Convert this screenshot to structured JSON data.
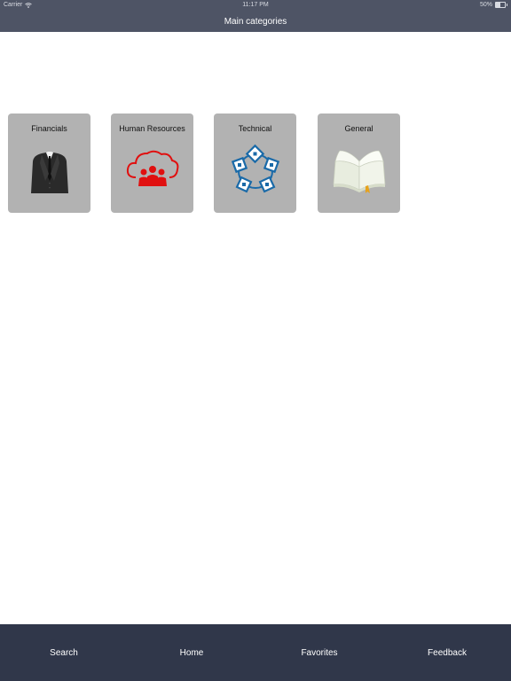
{
  "status_bar": {
    "carrier": "Carrier",
    "time": "11:17 PM",
    "battery": "50%"
  },
  "nav": {
    "title": "Main categories"
  },
  "categories": [
    {
      "label": "Financials",
      "icon": "suit-icon"
    },
    {
      "label": "Human Resources",
      "icon": "hr-cloud-people-icon"
    },
    {
      "label": "Technical",
      "icon": "network-cycle-icon"
    },
    {
      "label": "General",
      "icon": "open-book-icon"
    }
  ],
  "tabs": [
    {
      "label": "Search"
    },
    {
      "label": "Home"
    },
    {
      "label": "Favorites"
    },
    {
      "label": "Feedback"
    }
  ],
  "colors": {
    "header": "#4e5465",
    "tab_bar": "#30374a",
    "tile": "#b2b2b2",
    "hr_red": "#e01010",
    "tech_blue": "#1a6aa8"
  }
}
